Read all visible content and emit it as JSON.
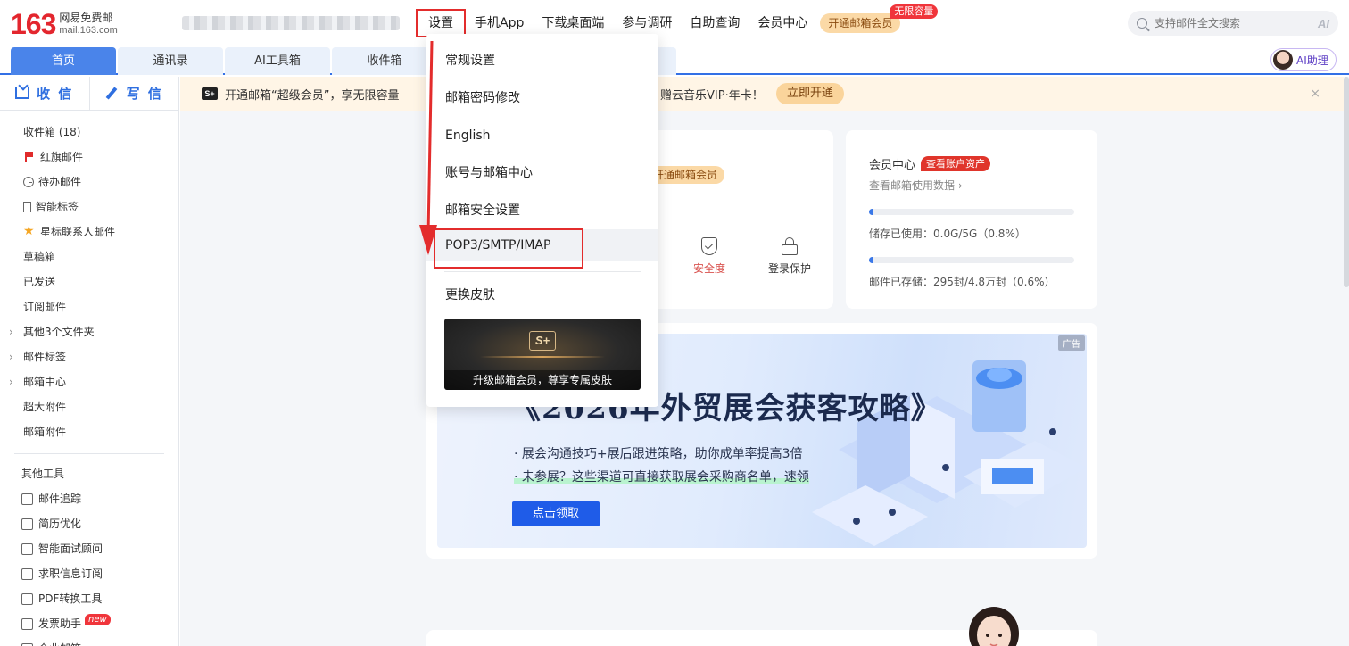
{
  "header": {
    "logo_number": "163",
    "logo_cn": "网易免费邮",
    "logo_url": "mail.163.com",
    "nav": [
      "设置",
      "手机App",
      "下载桌面端",
      "参与调研",
      "自助查询",
      "会员中心"
    ],
    "vip_button": "开通邮箱会员",
    "vip_tag": "无限容量",
    "search_placeholder": "支持邮件全文搜索",
    "search_ai": "AI"
  },
  "tabs": [
    "首页",
    "通讯录",
    "AI工具箱",
    "收件箱"
  ],
  "ai_assistant": "AI助理",
  "sidebar": {
    "receive": "收 信",
    "write": "写 信",
    "folders": [
      {
        "label": "收件箱 (18)",
        "icon": "none"
      },
      {
        "label": "红旗邮件",
        "icon": "red-flag-icon"
      },
      {
        "label": "待办邮件",
        "icon": "clock-icon"
      },
      {
        "label": "智能标签",
        "icon": "bookmark-icon"
      },
      {
        "label": "星标联系人邮件",
        "icon": "star-icon"
      },
      {
        "label": "草稿箱",
        "icon": "none"
      },
      {
        "label": "已发送",
        "icon": "none"
      },
      {
        "label": "订阅邮件",
        "icon": "none"
      },
      {
        "label": "其他3个文件夹",
        "icon": "chevron-right-icon"
      },
      {
        "label": "邮件标签",
        "icon": "chevron-right-icon"
      },
      {
        "label": "邮箱中心",
        "icon": "chevron-right-icon"
      },
      {
        "label": "超大附件",
        "icon": "none"
      },
      {
        "label": "邮箱附件",
        "icon": "none"
      }
    ],
    "tools_title": "其他工具",
    "tools": [
      "邮件追踪",
      "简历优化",
      "智能面试顾问",
      "求职信息订阅",
      "PDF转换工具",
      "发票助手",
      "企业邮箱"
    ],
    "new_badge": "new"
  },
  "promo": {
    "logo": "S+",
    "text_left": "开通邮箱“超级会员”，享无限容量",
    "text_right": "赠云音乐VIP·年卡！",
    "button": "立即开通",
    "close": "×"
  },
  "profile_card": {
    "vip_chip": "开通邮箱会员",
    "security": "安全度",
    "login_protect": "登录保护"
  },
  "member_card": {
    "title": "会员中心",
    "badge": "查看账户资产",
    "link": "查看邮箱使用数据 ›",
    "storage_label": "储存已使用：0.0G/5G（0.8%）",
    "storage_pct": 0.8,
    "mail_label": "邮件已存储：295封/4.8万封（0.6%）",
    "mail_pct": 0.6
  },
  "banner": {
    "ad": "广告",
    "title": "《2026年外贸展会获客攻略》",
    "line1": "·  展会沟通技巧+展后跟进策略，助你成单率提高3倍",
    "line2": "·  未参展？这些渠道可直接获取展会采购商名单，速领",
    "button": "点击领取"
  },
  "settings_menu": {
    "items": [
      "常规设置",
      "邮箱密码修改",
      "English",
      "账号与邮箱中心",
      "邮箱安全设置",
      "POP3/SMTP/IMAP",
      "更换皮肤"
    ],
    "skin_logo": "S+",
    "skin_caption": "升级邮箱会员，尊享专属皮肤"
  },
  "colors": {
    "brand_red": "#e3262e",
    "accent_blue": "#3370e6",
    "highlight_red": "#e32c2c"
  }
}
